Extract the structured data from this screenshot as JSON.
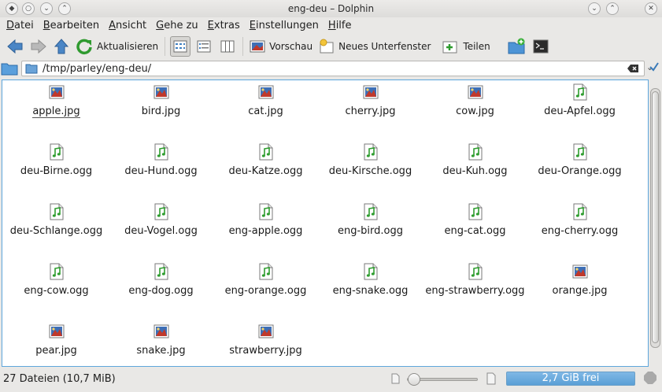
{
  "window": {
    "title": "eng-deu – Dolphin"
  },
  "menu": [
    "Datei",
    "Bearbeiten",
    "Ansicht",
    "Gehe zu",
    "Extras",
    "Einstellungen",
    "Hilfe"
  ],
  "toolbar": {
    "reload_label": "Aktualisieren",
    "preview_label": "Vorschau",
    "split_label": "Neues Unterfenster",
    "share_label": "Teilen"
  },
  "location": {
    "path": "/tmp/parley/eng-deu/"
  },
  "files": [
    {
      "name": "apple.jpg",
      "type": "image"
    },
    {
      "name": "bird.jpg",
      "type": "image"
    },
    {
      "name": "cat.jpg",
      "type": "image"
    },
    {
      "name": "cherry.jpg",
      "type": "image"
    },
    {
      "name": "cow.jpg",
      "type": "image"
    },
    {
      "name": "deu-Apfel.ogg",
      "type": "audio"
    },
    {
      "name": "deu-Birne.ogg",
      "type": "audio"
    },
    {
      "name": "deu-Hund.ogg",
      "type": "audio"
    },
    {
      "name": "deu-Katze.ogg",
      "type": "audio"
    },
    {
      "name": "deu-Kirsche.ogg",
      "type": "audio"
    },
    {
      "name": "deu-Kuh.ogg",
      "type": "audio"
    },
    {
      "name": "deu-Orange.ogg",
      "type": "audio"
    },
    {
      "name": "deu-Schlange.ogg",
      "type": "audio"
    },
    {
      "name": "deu-Vogel.ogg",
      "type": "audio"
    },
    {
      "name": "eng-apple.ogg",
      "type": "audio"
    },
    {
      "name": "eng-bird.ogg",
      "type": "audio"
    },
    {
      "name": "eng-cat.ogg",
      "type": "audio"
    },
    {
      "name": "eng-cherry.ogg",
      "type": "audio"
    },
    {
      "name": "eng-cow.ogg",
      "type": "audio"
    },
    {
      "name": "eng-dog.ogg",
      "type": "audio"
    },
    {
      "name": "eng-orange.ogg",
      "type": "audio"
    },
    {
      "name": "eng-snake.ogg",
      "type": "audio"
    },
    {
      "name": "eng-strawberry.ogg",
      "type": "audio"
    },
    {
      "name": "orange.jpg",
      "type": "image"
    },
    {
      "name": "pear.jpg",
      "type": "image"
    },
    {
      "name": "snake.jpg",
      "type": "image"
    },
    {
      "name": "strawberry.jpg",
      "type": "image"
    }
  ],
  "status": {
    "summary": "27 Dateien (10,7 MiB)",
    "free_space": "2,7 GiB frei",
    "zoom_level": 0.0
  },
  "colors": {
    "accent": "#5ea6dc",
    "free_space_bar": "#6aaee0"
  }
}
